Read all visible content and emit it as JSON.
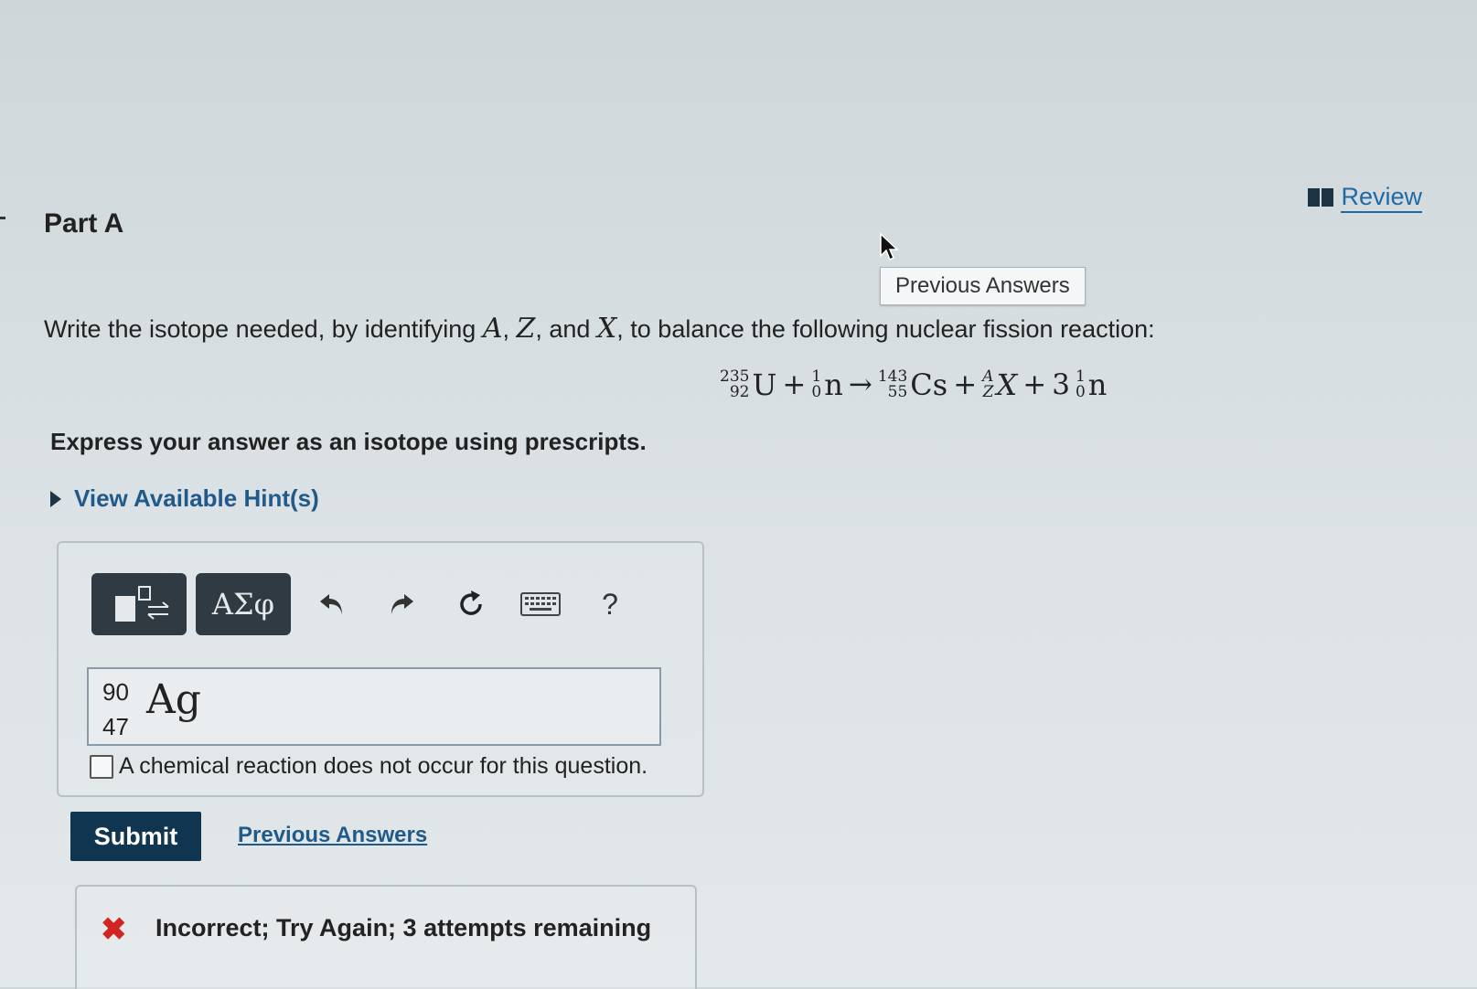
{
  "part": {
    "title": "Part A"
  },
  "review": {
    "label": "Review"
  },
  "tooltip": {
    "label": "Previous Answers"
  },
  "question": {
    "prefix": "Write the isotope needed, by identifying ",
    "var_a": "A",
    "sep1": ", ",
    "var_z": "Z",
    "sep2": ", and ",
    "var_x": "X",
    "suffix": ", to balance the following nuclear fission reaction:"
  },
  "equation": {
    "t1": {
      "mass": "235",
      "atomic": "92",
      "symbol": "U"
    },
    "plus1": "+",
    "t2": {
      "mass": "1",
      "atomic": "0",
      "symbol": "n"
    },
    "arrow": "→",
    "t3": {
      "mass": "143",
      "atomic": "55",
      "symbol": "Cs"
    },
    "plus2": "+",
    "t4": {
      "mass": "A",
      "atomic": "Z",
      "symbol": "X"
    },
    "plus3": "+",
    "coef": "3",
    "t5": {
      "mass": "1",
      "atomic": "0",
      "symbol": "n"
    }
  },
  "instruction": "Express your answer as an isotope using prescripts.",
  "hint": {
    "label": "View Available Hint(s)"
  },
  "toolbar": {
    "greek_label": "ΑΣφ",
    "help_label": "?"
  },
  "answer": {
    "mass": "90",
    "atomic": "47",
    "symbol": "Ag"
  },
  "checkbox": {
    "label": "A chemical reaction does not occur for this question.",
    "checked": false
  },
  "submit": {
    "label": "Submit"
  },
  "previous_answers_link": "Previous Answers",
  "feedback": {
    "text": "Incorrect; Try Again; 3 attempts remaining"
  }
}
